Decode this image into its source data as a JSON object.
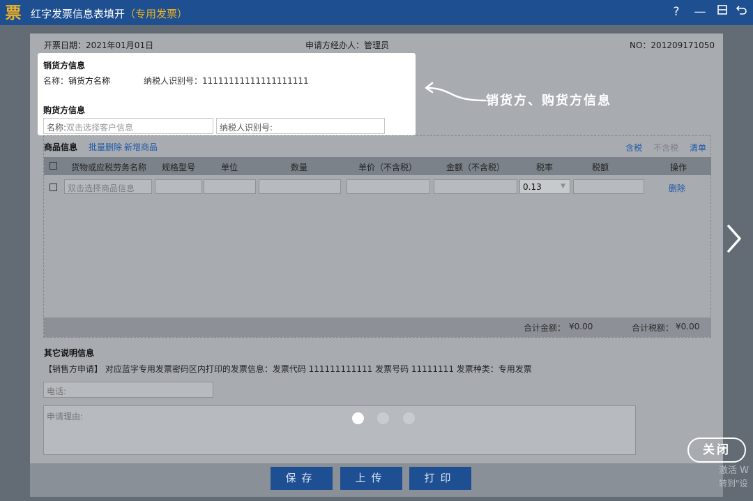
{
  "window": {
    "logo": "票",
    "title": "红字发票信息表填开",
    "title_accent": "（专用发票）",
    "controls": {
      "help": "?",
      "minimize": "—",
      "maximize": "口",
      "back": "⮌"
    }
  },
  "invoice": {
    "issue_date": "开票日期：2021年01月01日",
    "applicant": "申请方经办人：管理员",
    "number": "NO：201209171050"
  },
  "seller": {
    "heading": "销货方信息",
    "name_label": "名称：",
    "name_value": "销货方名称",
    "tax_id": "纳税人识别号：11111111111111111111"
  },
  "buyer": {
    "heading": "购货方信息",
    "name_label": "名称:",
    "name_placeholder": "双击选择客户信息",
    "tax_id_label": "纳税人识别号:"
  },
  "annotation": {
    "text": "销货方、购货方信息"
  },
  "goods": {
    "heading": "商品信息",
    "batch_delete": "批量删除",
    "add_item": "新增商品",
    "tax_included": "含税",
    "tax_excluded": "不含税",
    "list": "清单",
    "columns": [
      "货物或应税劳务名称",
      "规格型号",
      "单位",
      "数量",
      "单价（不含税）",
      "金额（不含税）",
      "税率",
      "税额",
      "操作"
    ],
    "row": {
      "name_placeholder": "双击选择商品信息",
      "tax_rate": "0.13",
      "delete": "删除"
    },
    "total_amount_label": "合计金额：",
    "total_amount_value": "¥0.00",
    "total_tax_label": "合计税额：",
    "total_tax_value": "¥0.00"
  },
  "other": {
    "heading": "其它说明信息",
    "note": "【销售方申请】 对应蓝字专用发票密码区内打印的发票信息：发票代码 111111111111 发票号码 11111111 发票种类：专用发票",
    "phone_placeholder": "电话:",
    "reason_placeholder": "申请理由:"
  },
  "actions": {
    "save": "保存",
    "upload": "上传",
    "print": "打印"
  },
  "tutorial": {
    "close": "关闭",
    "pages": 3,
    "current_page": 1
  },
  "watermark": {
    "line1": "激活 W",
    "line2": "转到\"设"
  }
}
